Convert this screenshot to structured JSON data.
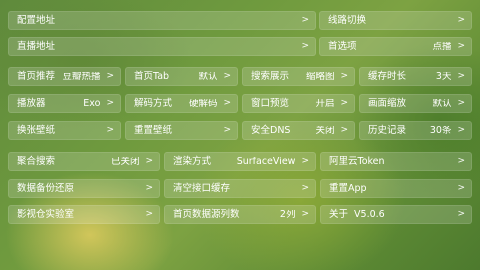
{
  "settings": {
    "config_url": {
      "label": "配置地址",
      "chevron": ">"
    },
    "route_switch": {
      "label": "线路切换",
      "chevron": ">"
    },
    "live_url": {
      "label": "直播地址",
      "chevron": ">"
    },
    "preferences": {
      "label": "首选项",
      "value": "点播",
      "chevron": ">"
    },
    "home_recommend": {
      "label": "首页推荐",
      "value": "豆瓣热播",
      "chevron": ">"
    },
    "home_tab": {
      "label": "首页Tab",
      "value": "默认",
      "chevron": ">"
    },
    "search_display": {
      "label": "搜索展示",
      "value": "缩略图",
      "chevron": ">"
    },
    "cache_duration": {
      "label": "缓存时长",
      "value": "3天",
      "chevron": ">"
    },
    "player": {
      "label": "播放器",
      "value": "Exo",
      "chevron": ">"
    },
    "decode_mode": {
      "label": "解码方式",
      "value": "硬解码",
      "chevron": ">"
    },
    "window_preview": {
      "label": "窗口预览",
      "value": "开启",
      "chevron": ">"
    },
    "picture_scale": {
      "label": "画面缩放",
      "value": "默认",
      "chevron": ">"
    },
    "change_wallpaper": {
      "label": "换张壁纸",
      "chevron": ">"
    },
    "reset_wallpaper": {
      "label": "重置壁纸",
      "chevron": ">"
    },
    "safe_dns": {
      "label": "安全DNS",
      "value": "关闭",
      "chevron": ">"
    },
    "history": {
      "label": "历史记录",
      "value": "30条",
      "chevron": ">"
    },
    "aggregate_search": {
      "label": "聚合搜索",
      "value": "已关闭",
      "chevron": ">"
    },
    "render_mode": {
      "label": "渲染方式",
      "value": "SurfaceView",
      "chevron": ">"
    },
    "aliyun_token": {
      "label": "阿里云Token",
      "chevron": ">"
    },
    "backup_restore": {
      "label": "数据备份还原",
      "chevron": ">"
    },
    "clear_cache": {
      "label": "清空接口缓存",
      "chevron": ">"
    },
    "reset_app": {
      "label": "重置App",
      "chevron": ">"
    },
    "lab": {
      "label": "影视仓实验室",
      "chevron": ">"
    },
    "home_columns": {
      "label": "首页数据源列数",
      "value": "2列",
      "chevron": ">"
    },
    "about": {
      "label": "关于  V5.0.6",
      "chevron": ">"
    }
  }
}
